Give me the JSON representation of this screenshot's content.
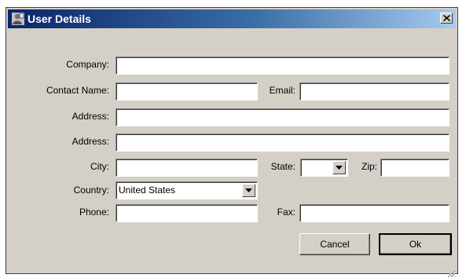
{
  "window": {
    "title": "User Details",
    "app_icon": "user-details-app-icon",
    "close_icon": "close-icon"
  },
  "form": {
    "company_label": "Company:",
    "company_value": "",
    "contact_name_label": "Contact Name:",
    "contact_name_value": "",
    "email_label": "Email:",
    "email_value": "",
    "address1_label": "Address:",
    "address1_value": "",
    "address2_label": "Address:",
    "address2_value": "",
    "city_label": "City:",
    "city_value": "",
    "state_label": "State:",
    "state_value": "",
    "zip_label": "Zip:",
    "zip_value": "",
    "country_label": "Country:",
    "country_value": "United States",
    "phone_label": "Phone:",
    "phone_value": "",
    "fax_label": "Fax:",
    "fax_value": ""
  },
  "buttons": {
    "cancel_label": "Cancel",
    "ok_label": "Ok"
  },
  "colors": {
    "title_start": "#0a246a",
    "title_end": "#a6caf0",
    "face": "#d4d0c8"
  }
}
